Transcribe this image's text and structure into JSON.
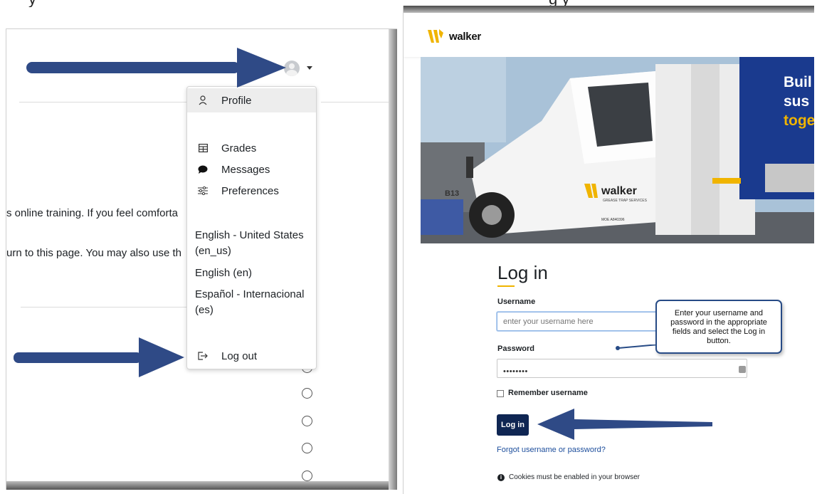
{
  "caption": {
    "left_fragment": "y",
    "right_fragment": "g y"
  },
  "left_panel": {
    "user_menu": {
      "items": [
        {
          "label": "Profile",
          "icon": "person-icon",
          "active": true
        },
        {
          "label": "Grades",
          "icon": "grades-table-icon"
        },
        {
          "label": "Messages",
          "icon": "speech-bubble-icon"
        },
        {
          "label": "Preferences",
          "icon": "sliders-icon"
        },
        {
          "label": "Log out",
          "icon": "logout-icon"
        }
      ],
      "languages": [
        "English - United States (en_us)",
        "English (en)",
        "Español - Internacional (es)"
      ]
    },
    "page_text": {
      "line1": "s online training. If you feel comforta",
      "line2": "urn to this page. You may also use th"
    },
    "colors": {
      "arrow": "#2f4a86"
    }
  },
  "right_panel": {
    "logo_text": "walker",
    "hero": {
      "side_text": [
        "Buil",
        "sus",
        "toge"
      ],
      "truck_door_logo": "walker",
      "truck_door_sub": "GREASE TRAP SERVICES",
      "truck_number": "B13",
      "moe_text": "MOE A840396"
    },
    "login": {
      "title": "Log in",
      "username_label": "Username",
      "username_placeholder": "enter your username here",
      "password_label": "Password",
      "password_value": "••••••••",
      "remember_label": "Remember username",
      "button_label": "Log in",
      "forgot_link": "Forgot username or password?",
      "cookies_notice": "Cookies must be enabled in your browser"
    },
    "callout": "Enter your username and password in the appropriate fields and select the Log in button.",
    "colors": {
      "button": "#0f2653",
      "accent": "#f0b400",
      "link": "#1d4e9c"
    }
  }
}
